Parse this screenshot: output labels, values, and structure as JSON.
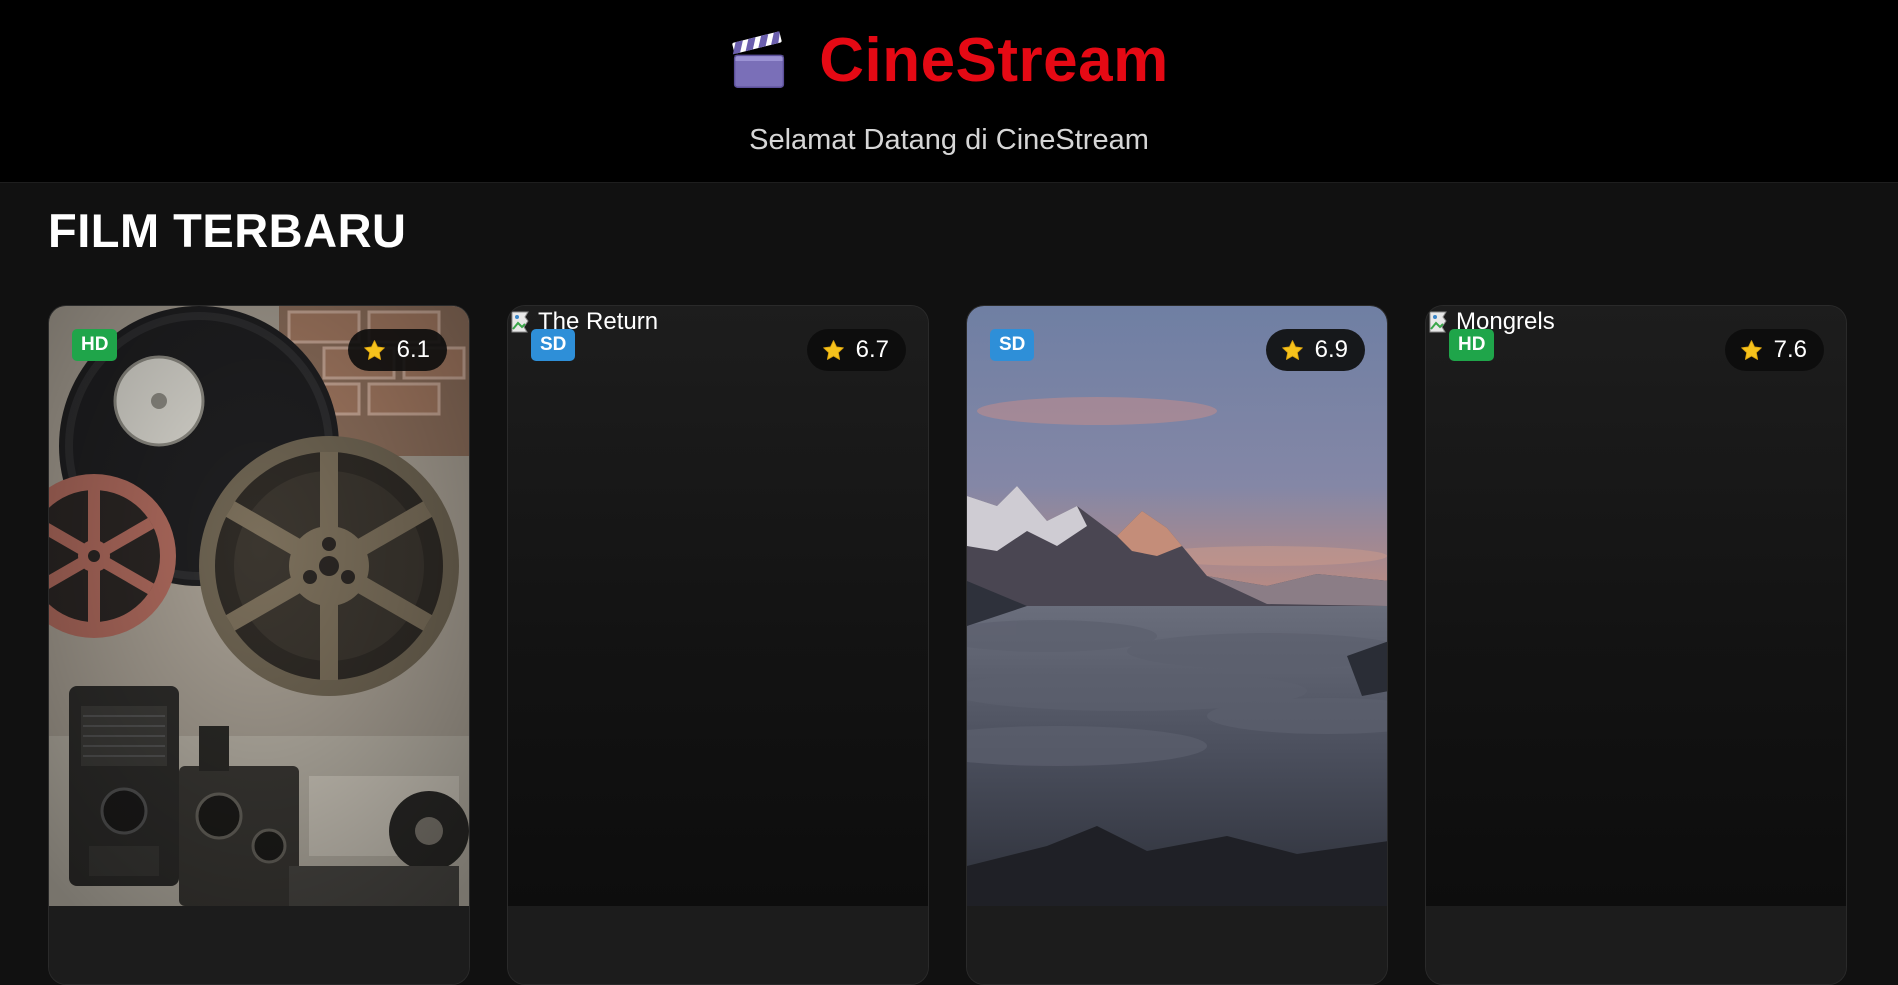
{
  "header": {
    "logo_icon": "clapperboard-icon",
    "brand_name": "CineStream",
    "brand_color": "#e50914",
    "tagline": "Selamat Datang di CineStream"
  },
  "section": {
    "title": "FILM TERBARU"
  },
  "movies": [
    {
      "alt": "",
      "quality": "HD",
      "quality_color": "#1fa54a",
      "rating": "6.1",
      "poster": "film-reels-photo",
      "image_loaded": true
    },
    {
      "alt": "The Return",
      "quality": "SD",
      "quality_color": "#2e8fd8",
      "rating": "6.7",
      "poster": "broken-image",
      "image_loaded": false
    },
    {
      "alt": "",
      "quality": "SD",
      "quality_color": "#2e8fd8",
      "rating": "6.9",
      "poster": "mountain-clouds-photo",
      "image_loaded": true
    },
    {
      "alt": "Mongrels",
      "quality": "HD",
      "quality_color": "#1fa54a",
      "rating": "7.6",
      "poster": "broken-image",
      "image_loaded": false
    }
  ],
  "icons": {
    "rating": "star-icon",
    "broken": "broken-image-icon"
  }
}
